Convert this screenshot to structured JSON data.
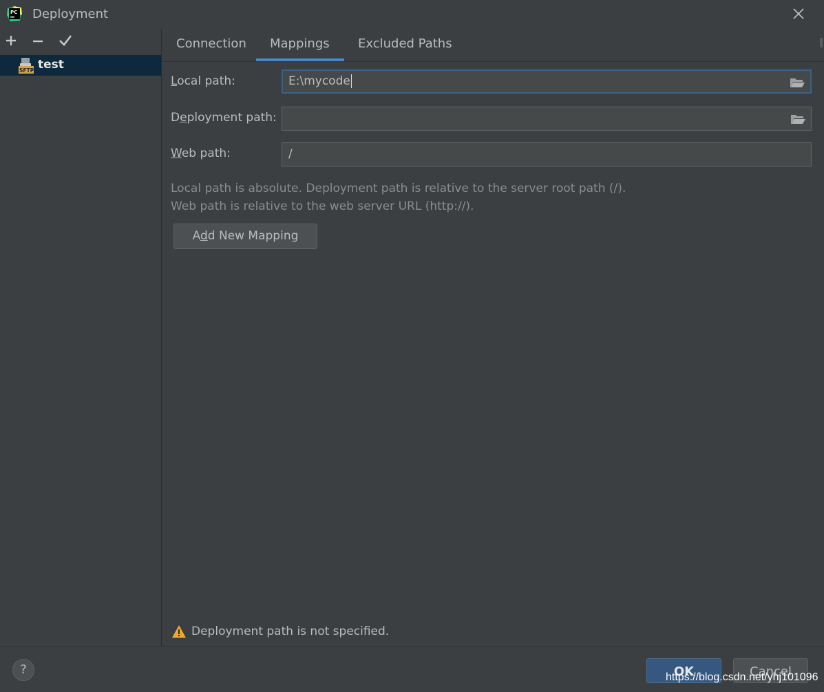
{
  "window": {
    "title": "Deployment",
    "logo_text": "PC"
  },
  "toolbar": {
    "add_icon": "plus-icon",
    "remove_icon": "minus-icon",
    "apply_icon": "check-icon"
  },
  "servers": [
    {
      "name": "test",
      "type_badge": "SFTP",
      "selected": true
    }
  ],
  "tabs": [
    {
      "label": "Connection",
      "active": false
    },
    {
      "label": "Mappings",
      "active": true
    },
    {
      "label": "Excluded Paths",
      "active": false
    }
  ],
  "mappings": {
    "local_path": {
      "label_pre": "",
      "label_key": "L",
      "label_post": "ocal path:",
      "value": "E:\\mycode"
    },
    "deployment_path": {
      "label_pre": "D",
      "label_key": "e",
      "label_post": "ployment path:",
      "value": ""
    },
    "web_path": {
      "label_pre": "",
      "label_key": "W",
      "label_post": "eb path:",
      "value": "/"
    },
    "hint_line1": "Local path is absolute. Deployment path is relative to the server root path (/).",
    "hint_line2": "Web path is relative to the web server URL (http://).",
    "add_button": {
      "pre": "A",
      "key": "d",
      "post": "d New Mapping"
    }
  },
  "warning": {
    "text": "Deployment path is not specified."
  },
  "footer": {
    "help_label": "?",
    "ok_label": "OK",
    "cancel_label": "Cancel",
    "watermark": "https://blog.csdn.net/yhj101096"
  },
  "colors": {
    "background": "#3c3f41",
    "selection": "#0d293e",
    "accent": "#4a88c7",
    "warning": "#f0a732"
  }
}
